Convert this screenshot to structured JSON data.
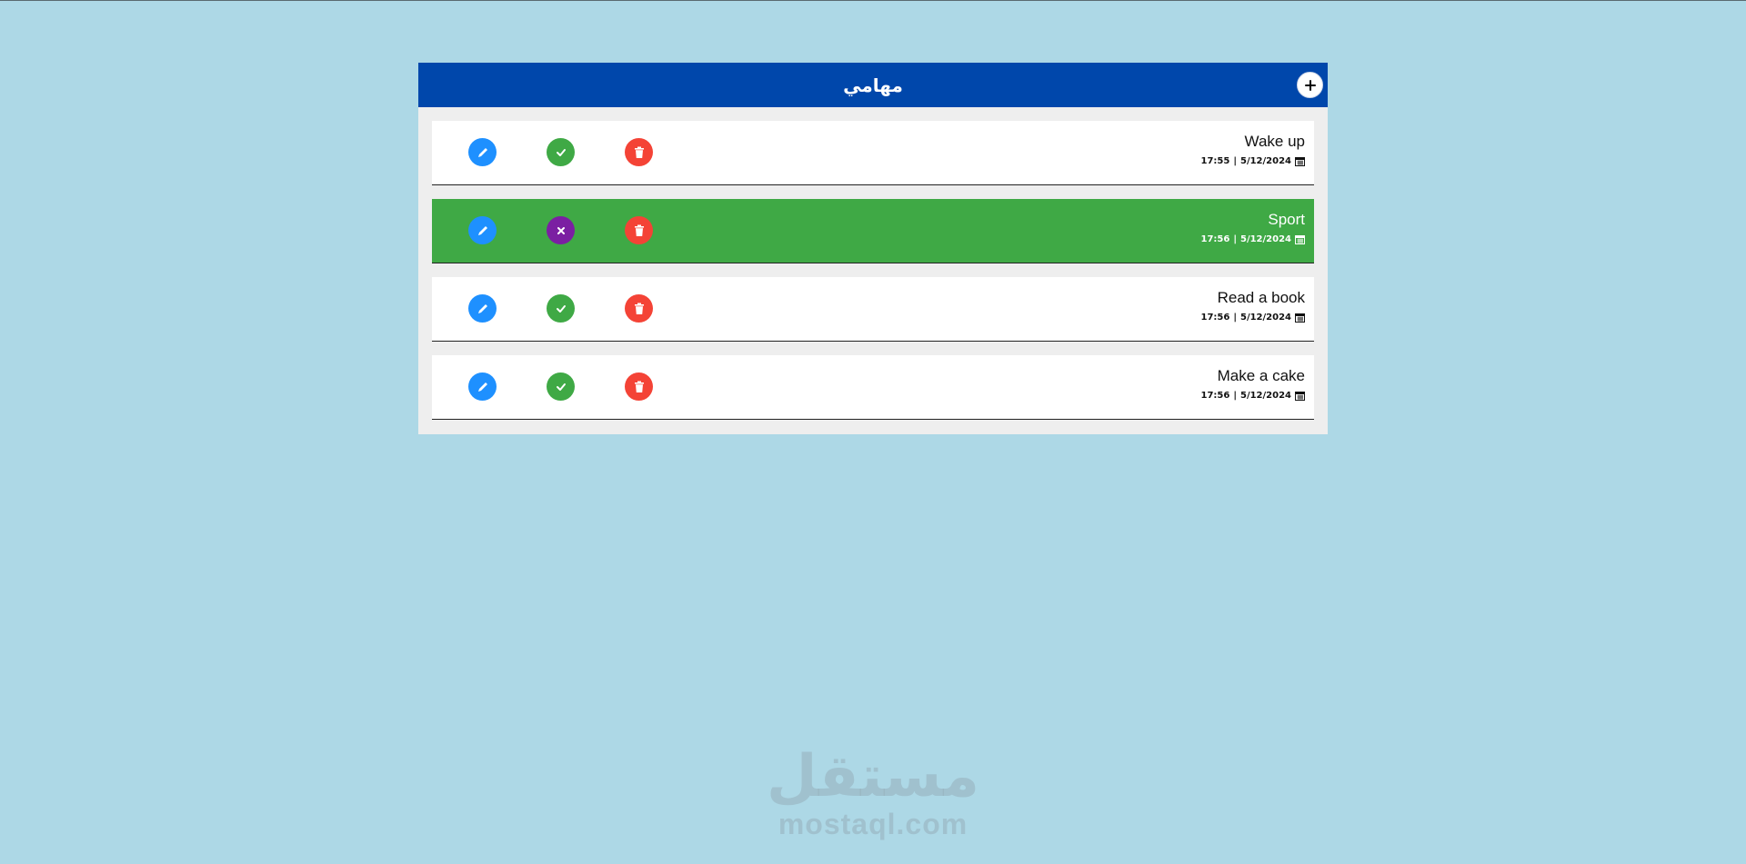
{
  "header": {
    "title": "مهامي",
    "add_button_icon": "plus-icon"
  },
  "tasks": [
    {
      "title": "Wake up",
      "time": "17:55",
      "date": "5/12/2024",
      "status": "pending"
    },
    {
      "title": "Sport",
      "time": "17:56",
      "date": "5/12/2024",
      "status": "done"
    },
    {
      "title": "Read a book",
      "time": "17:56",
      "date": "5/12/2024",
      "status": "pending"
    },
    {
      "title": "Make a cake",
      "time": "17:56",
      "date": "5/12/2024",
      "status": "pending"
    }
  ],
  "date_separator": "|",
  "watermark": {
    "arabic": "مستقل",
    "latin": "mostaql.com"
  },
  "colors": {
    "background": "#add8e6",
    "header": "#0047ab",
    "done_row": "#3fa945",
    "edit": "#1e90ff",
    "check": "#3fa945",
    "undo": "#7b1fa2",
    "delete": "#f44336"
  }
}
